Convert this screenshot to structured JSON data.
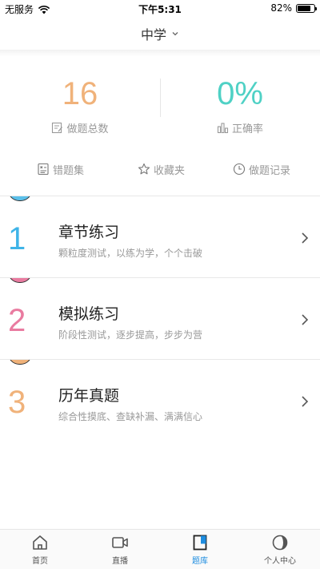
{
  "status": {
    "carrier": "无服务",
    "time": "下午5:31",
    "battery": "82%",
    "battery_level": 0.82
  },
  "header": {
    "title": "中学"
  },
  "stats": {
    "questions_done": {
      "value": "16",
      "label": "做题总数",
      "color": "#f0b27a"
    },
    "accuracy": {
      "value": "0%",
      "label": "正确率",
      "color": "#4fd1c5"
    }
  },
  "quick_links": [
    {
      "label": "错题集",
      "icon": "error-book-icon"
    },
    {
      "label": "收藏夹",
      "icon": "star-icon"
    },
    {
      "label": "做题记录",
      "icon": "clock-icon"
    }
  ],
  "practices": [
    {
      "number": "1",
      "title": "章节练习",
      "subtitle": "颗粒度测试，以练为学，个个击破",
      "color": "#3fb4e8",
      "bump_color": "#5bc0ea"
    },
    {
      "number": "2",
      "title": "模拟练习",
      "subtitle": "阶段性测试，逐步提高，步步为营",
      "color": "#e97ba0",
      "bump_color": "#e97ba0"
    },
    {
      "number": "3",
      "title": "历年真题",
      "subtitle": "综合性摸底、查缺补漏、满满信心",
      "color": "#f0b27a",
      "bump_color": "#f0b27a"
    }
  ],
  "tabs": [
    {
      "label": "首页",
      "icon": "home-icon",
      "active": false
    },
    {
      "label": "直播",
      "icon": "video-camera-icon",
      "active": false
    },
    {
      "label": "题库",
      "icon": "question-bank-icon",
      "active": true
    },
    {
      "label": "个人中心",
      "icon": "profile-icon",
      "active": false
    }
  ],
  "colors": {
    "accent": "#1e8de0"
  }
}
